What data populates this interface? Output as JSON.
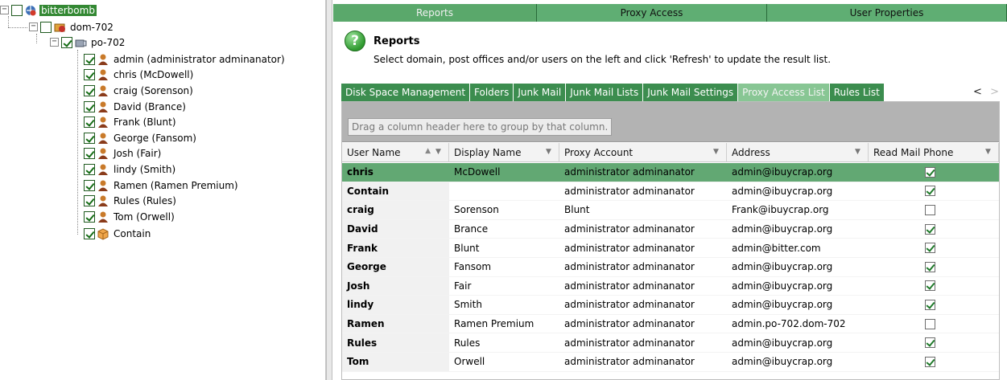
{
  "tree": {
    "nodes": [
      {
        "label": "bitterbomb",
        "checked": false,
        "type": "system",
        "expanded": true
      },
      {
        "label": "dom-702",
        "checked": false,
        "type": "domain",
        "expanded": true
      },
      {
        "label": "po-702",
        "checked": true,
        "type": "postoffice",
        "expanded": true
      },
      {
        "label": "admin (administrator  adminanator)",
        "checked": true,
        "type": "user"
      },
      {
        "label": "chris (McDowell)",
        "checked": true,
        "type": "user"
      },
      {
        "label": "craig (Sorenson)",
        "checked": true,
        "type": "user"
      },
      {
        "label": "David (Brance)",
        "checked": true,
        "type": "user"
      },
      {
        "label": "Frank (Blunt)",
        "checked": true,
        "type": "user"
      },
      {
        "label": "George (Fansom)",
        "checked": true,
        "type": "user"
      },
      {
        "label": "Josh (Fair)",
        "checked": true,
        "type": "user"
      },
      {
        "label": "lindy (Smith)",
        "checked": true,
        "type": "user"
      },
      {
        "label": "Ramen (Ramen Premium)",
        "checked": true,
        "type": "user"
      },
      {
        "label": "Rules (Rules)",
        "checked": true,
        "type": "user"
      },
      {
        "label": "Tom (Orwell)",
        "checked": true,
        "type": "user"
      },
      {
        "label": "Contain",
        "checked": true,
        "type": "resource"
      }
    ]
  },
  "topnav": {
    "tabs": [
      "Reports",
      "Proxy Access",
      "User Properties"
    ]
  },
  "header": {
    "icon_glyph": "?",
    "title": "Reports",
    "description": "Select domain, post offices and/or users on the left and click 'Refresh' to update the result list."
  },
  "subtabs": {
    "tabs": [
      "Disk Space Management",
      "Folders",
      "Junk Mail",
      "Junk Mail Lists",
      "Junk Mail Settings",
      "Proxy Access List",
      "Rules List"
    ],
    "active": "Proxy Access List",
    "scroll_left": "<",
    "scroll_right": ">"
  },
  "grid": {
    "group_hint": "Drag a column header here to group by that column.",
    "columns": [
      "User Name",
      "Display Name",
      "Proxy Account",
      "Address",
      "Read Mail Phone"
    ],
    "rows": [
      {
        "user": "chris",
        "display": "McDowell",
        "proxy": "administrator  adminanator",
        "address": "admin@ibuycrap.org",
        "read": true,
        "selected": true
      },
      {
        "user": "Contain",
        "display": "",
        "proxy": "administrator  adminanator",
        "address": "admin@ibuycrap.org",
        "read": true
      },
      {
        "user": "craig",
        "display": "Sorenson",
        "proxy": "Blunt",
        "address": "Frank@ibuycrap.org",
        "read": false
      },
      {
        "user": "David",
        "display": "Brance",
        "proxy": "administrator  adminanator",
        "address": "admin@ibuycrap.org",
        "read": true
      },
      {
        "user": "Frank",
        "display": "Blunt",
        "proxy": "administrator  adminanator",
        "address": "admin@bitter.com",
        "read": true
      },
      {
        "user": "George",
        "display": "Fansom",
        "proxy": "administrator  adminanator",
        "address": "admin@ibuycrap.org",
        "read": true
      },
      {
        "user": "Josh",
        "display": "Fair",
        "proxy": "administrator  adminanator",
        "address": "admin@ibuycrap.org",
        "read": true
      },
      {
        "user": "lindy",
        "display": "Smith",
        "proxy": "administrator  adminanator",
        "address": "admin@ibuycrap.org",
        "read": true
      },
      {
        "user": "Ramen",
        "display": "Ramen Premium",
        "proxy": "administrator  adminanator",
        "address": "admin.po-702.dom-702",
        "read": false
      },
      {
        "user": "Rules",
        "display": "Rules",
        "proxy": "administrator  adminanator",
        "address": "admin@ibuycrap.org",
        "read": true
      },
      {
        "user": "Tom",
        "display": "Orwell",
        "proxy": "administrator  adminanator",
        "address": "admin@ibuycrap.org",
        "read": true
      }
    ]
  },
  "colors": {
    "accent_green": "#3c8d4f",
    "selection_green": "#62a873",
    "group_bar_gray": "#b3b3b3"
  }
}
